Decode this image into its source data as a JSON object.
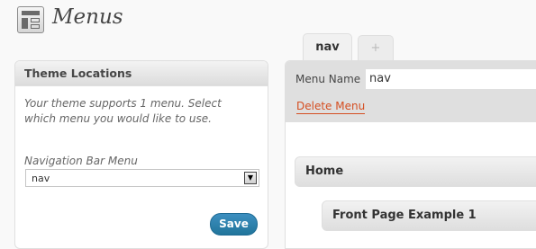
{
  "header": {
    "title": "Menus",
    "icon": "menus-icon"
  },
  "theme_locations": {
    "title": "Theme Locations",
    "description": "Your theme supports 1 menu. Select which menu you would like to use.",
    "nav_label": "Navigation Bar Menu",
    "nav_selected": "nav",
    "save_label": "Save"
  },
  "tabs": [
    {
      "label": "nav",
      "active": true
    },
    {
      "label": "+",
      "active": false
    }
  ],
  "menu_edit": {
    "name_label": "Menu Name",
    "name_value": "nav",
    "delete_label": "Delete Menu",
    "items": [
      {
        "label": "Home",
        "depth": 0
      },
      {
        "label": "Front Page Example 1",
        "depth": 1
      }
    ]
  },
  "colors": {
    "primary_button": "#21759b",
    "delete_link": "#d54e21"
  }
}
